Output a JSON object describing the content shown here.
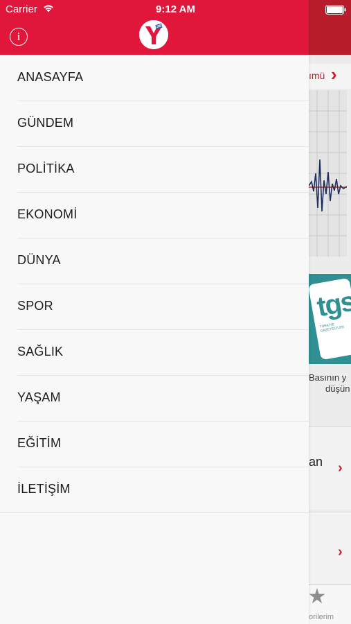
{
  "status_bar": {
    "carrier": "Carrier",
    "time": "9:12 AM"
  },
  "drawer": {
    "header_color": "#e0173a",
    "info_icon": "info-icon",
    "logo_letter": "Y",
    "menu_items": [
      {
        "label": "ANASAYFA"
      },
      {
        "label": "GÜNDEM"
      },
      {
        "label": "POLİTİKA"
      },
      {
        "label": "EKONOMİ"
      },
      {
        "label": "DÜNYA"
      },
      {
        "label": "SPOR"
      },
      {
        "label": "SAĞLIK"
      },
      {
        "label": "YAŞAM"
      },
      {
        "label": "EĞİTİM"
      },
      {
        "label": "İLETİŞİM"
      }
    ]
  },
  "background_app": {
    "section_link_text": "ımü",
    "card_caption_line1": "Basının y",
    "card_caption_line2": "düşün",
    "card_logo_text": "tgs",
    "card_logo_sub": "TÜRKİYE GAZETECİLER",
    "row1_text": "an",
    "tab_label": "orilerim",
    "accent_color": "#d0182a"
  }
}
